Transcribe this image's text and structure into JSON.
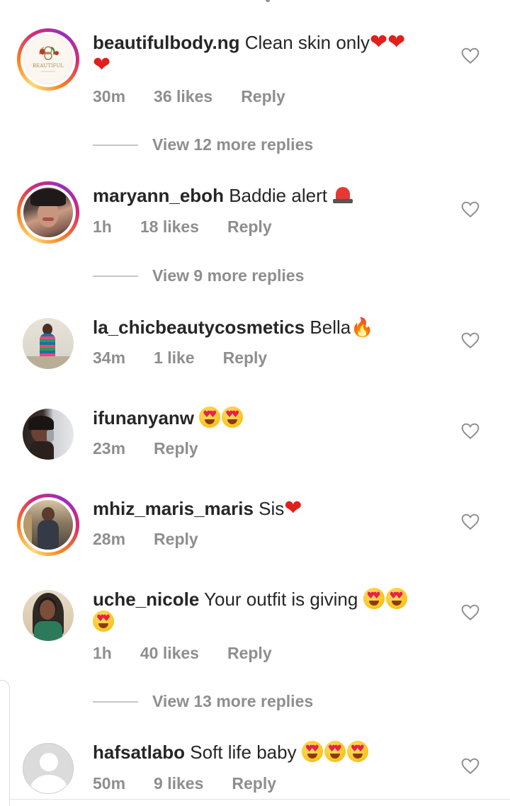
{
  "comments": [
    {
      "username": "beautifulbody.ng",
      "text": "Clean skin only",
      "emoji": "❤️❤️❤️",
      "time": "30m",
      "likes": "36 likes",
      "reply": "Reply",
      "view_replies": "View 12 more replies",
      "story_ring": true
    },
    {
      "username": "maryann_eboh",
      "text": "Baddie alert",
      "emoji": "🚨",
      "time": "1h",
      "likes": "18 likes",
      "reply": "Reply",
      "view_replies": "View 9 more replies",
      "story_ring": true
    },
    {
      "username": "la_chicbeautycosmetics",
      "text": "Bella",
      "emoji": "🔥",
      "time": "34m",
      "likes": "1 like",
      "reply": "Reply",
      "story_ring": false
    },
    {
      "username": "ifunanyanw",
      "text": "",
      "emoji": "😍😍",
      "time": "23m",
      "reply": "Reply",
      "story_ring": false
    },
    {
      "username": "mhiz_maris_maris",
      "text": "Sis",
      "emoji": "❤️",
      "time": "28m",
      "reply": "Reply",
      "story_ring": true
    },
    {
      "username": "uche_nicole",
      "text": "Your outfit is giving",
      "emoji": "😍😍😍",
      "time": "1h",
      "likes": "40 likes",
      "reply": "Reply",
      "view_replies": "View 13 more replies",
      "story_ring": false
    },
    {
      "username": "hafsatlabo",
      "text": "Soft life baby",
      "emoji": "😍😍😍",
      "time": "50m",
      "likes": "9 likes",
      "reply": "Reply",
      "story_ring": false
    }
  ],
  "avatar_logo_text": "BEAUTIFUL",
  "colors": {
    "text": "#262626",
    "muted": "#8e8e8e",
    "heart": "#e0201a"
  }
}
